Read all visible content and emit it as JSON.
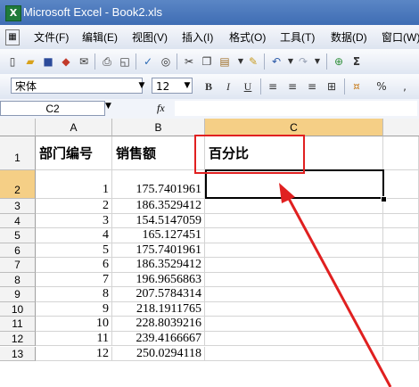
{
  "window": {
    "title": "Microsoft Excel - Book2.xls"
  },
  "menu": {
    "items": [
      {
        "label": "文件(F)"
      },
      {
        "label": "编辑(E)"
      },
      {
        "label": "视图(V)"
      },
      {
        "label": "插入(I)"
      },
      {
        "label": "格式(O)"
      },
      {
        "label": "工具(T)"
      },
      {
        "label": "数据(D)"
      },
      {
        "label": "窗口(W)"
      }
    ]
  },
  "format_toolbar": {
    "font": "宋体",
    "size": "12",
    "bold": "B",
    "italic": "I",
    "underline": "U",
    "percent": "%"
  },
  "formula_bar": {
    "name_box": "C2",
    "fx": "fx",
    "content": ""
  },
  "columns": [
    "A",
    "B",
    "C"
  ],
  "header_row": {
    "row": "1",
    "a": "部门编号",
    "b": "销售额",
    "c": "百分比"
  },
  "rows": [
    {
      "row": "2",
      "a": "1",
      "b": "175.7401961"
    },
    {
      "row": "3",
      "a": "2",
      "b": "186.3529412"
    },
    {
      "row": "4",
      "a": "3",
      "b": "154.5147059"
    },
    {
      "row": "5",
      "a": "4",
      "b": "165.127451"
    },
    {
      "row": "6",
      "a": "5",
      "b": "175.7401961"
    },
    {
      "row": "7",
      "a": "6",
      "b": "186.3529412"
    },
    {
      "row": "8",
      "a": "7",
      "b": "196.9656863"
    },
    {
      "row": "9",
      "a": "8",
      "b": "207.5784314"
    },
    {
      "row": "10",
      "a": "9",
      "b": "218.1911765"
    },
    {
      "row": "11",
      "a": "10",
      "b": "228.8039216"
    },
    {
      "row": "12",
      "a": "11",
      "b": "239.4166667"
    },
    {
      "row": "13",
      "a": "12",
      "b": "250.0294118"
    }
  ],
  "colors": {
    "highlight": "#e02020",
    "active_header": "#f5cf86"
  }
}
